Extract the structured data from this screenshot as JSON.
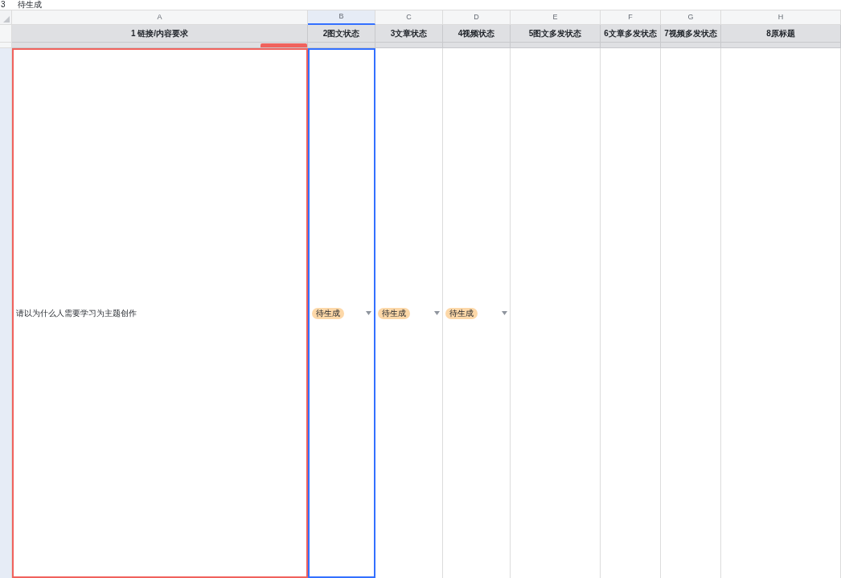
{
  "formula_bar": {
    "cell_ref": "3",
    "value": "待生成"
  },
  "columns": [
    {
      "letter": "A",
      "header": "1 链接/内容要求",
      "selected": false
    },
    {
      "letter": "B",
      "header": "2图文状态",
      "selected": true
    },
    {
      "letter": "C",
      "header": "3文章状态",
      "selected": false
    },
    {
      "letter": "D",
      "header": "4视频状态",
      "selected": false
    },
    {
      "letter": "E",
      "header": "5图文多发状态",
      "selected": false
    },
    {
      "letter": "F",
      "header": "6文章多发状态",
      "selected": false
    },
    {
      "letter": "G",
      "header": "7视频多发状态",
      "selected": false
    },
    {
      "letter": "H",
      "header": "8原标题",
      "selected": false
    }
  ],
  "row": {
    "selected": true,
    "cells": [
      {
        "kind": "text",
        "text": "请以为什么人需要学习为主题创作",
        "selected": false,
        "flagged": true
      },
      {
        "kind": "tag",
        "text": "待生成",
        "selected": true,
        "flagged": false
      },
      {
        "kind": "tag",
        "text": "待生成",
        "selected": false,
        "flagged": false
      },
      {
        "kind": "tag",
        "text": "待生成",
        "selected": false,
        "flagged": false
      },
      {
        "kind": "empty",
        "selected": false,
        "flagged": false
      },
      {
        "kind": "empty",
        "selected": false,
        "flagged": false
      },
      {
        "kind": "empty",
        "selected": false,
        "flagged": false
      },
      {
        "kind": "empty",
        "selected": false,
        "flagged": false
      }
    ]
  }
}
